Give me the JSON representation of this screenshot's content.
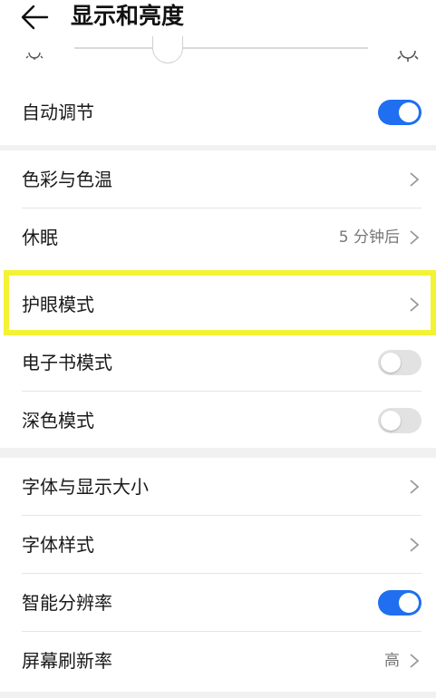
{
  "header": {
    "title": "显示和亮度",
    "back_icon": "arrow-left-icon"
  },
  "brightness": {
    "min_icon": "sun-small-icon",
    "max_icon": "sun-large-icon",
    "level": 0.3
  },
  "auto_adjust": {
    "label": "自动调节",
    "enabled": true
  },
  "group1": {
    "color_temp": {
      "label": "色彩与色温"
    },
    "sleep": {
      "label": "休眠",
      "value": "5 分钟后"
    },
    "eye_comfort": {
      "label": "护眼模式"
    },
    "ebook_mode": {
      "label": "电子书模式",
      "enabled": false
    },
    "dark_mode": {
      "label": "深色模式",
      "enabled": false
    }
  },
  "group2": {
    "font_size": {
      "label": "字体与显示大小"
    },
    "font_style": {
      "label": "字体样式"
    },
    "smart_resolution": {
      "label": "智能分辨率",
      "enabled": true
    },
    "refresh_rate": {
      "label": "屏幕刷新率",
      "value": "高"
    }
  },
  "colors": {
    "accent": "#1f6ff0",
    "highlight": "#f4f234",
    "toggle_off": "#e2e2e2"
  }
}
